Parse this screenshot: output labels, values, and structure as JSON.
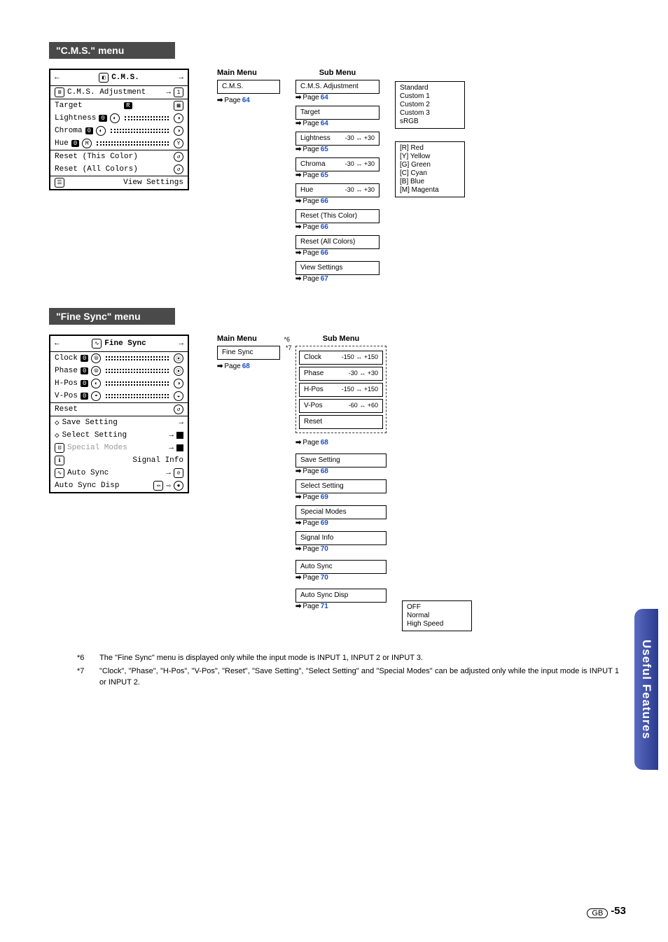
{
  "sidebar": {
    "label": "Useful Features"
  },
  "cms": {
    "title": "\"C.M.S.\" menu",
    "osd": {
      "title": "C.M.S.",
      "adjustment": "C.M.S. Adjustment",
      "adjustment_mode": "1",
      "target_label": "Target",
      "target_val": "R",
      "lightness_label": "Lightness",
      "lightness_val": "0",
      "chroma_label": "Chroma",
      "chroma_val": "0",
      "hue_label": "Hue",
      "hue_val": "0",
      "reset_this": "Reset (This Color)",
      "reset_all": "Reset (All Colors)",
      "view_settings": "View Settings"
    },
    "tree": {
      "main_heading": "Main Menu",
      "sub_heading": "Sub Menu",
      "main": {
        "label": "C.M.S.",
        "page": "64"
      },
      "subs": [
        {
          "label": "C.M.S. Adjustment",
          "page": "64",
          "opts": [
            "Standard",
            "Custom 1",
            "Custom 2",
            "Custom 3",
            "sRGB"
          ]
        },
        {
          "label": "Target",
          "page": "64",
          "opts": [
            "[R]  Red",
            "[Y]  Yellow",
            "[G]  Green",
            "[C]  Cyan",
            "[B]  Blue",
            "[M]  Magenta"
          ]
        },
        {
          "label": "Lightness",
          "range": "-30 ↔ +30",
          "page": "65"
        },
        {
          "label": "Chroma",
          "range": "-30 ↔ +30",
          "page": "65"
        },
        {
          "label": "Hue",
          "range": "-30 ↔ +30",
          "page": "66"
        },
        {
          "label": "Reset (This Color)",
          "page": "66"
        },
        {
          "label": "Reset (All Colors)",
          "page": "66"
        },
        {
          "label": "View Settings",
          "page": "67"
        }
      ]
    }
  },
  "fs": {
    "title": "\"Fine Sync\" menu",
    "osd": {
      "title": "Fine Sync",
      "clock": "Clock",
      "clock_val": "0",
      "phase": "Phase",
      "phase_val": "0",
      "hpos": "H-Pos",
      "hpos_val": "0",
      "vpos": "V-Pos",
      "vpos_val": "0",
      "reset": "Reset",
      "save": "Save Setting",
      "select": "Select Setting",
      "special": "Special Modes",
      "signal": "Signal Info",
      "autosync": "Auto Sync",
      "autosync_disp": "Auto Sync Disp"
    },
    "tree": {
      "main_heading": "Main Menu",
      "sub_heading": "Sub Menu",
      "star6": "*6",
      "star7": "*7",
      "main": {
        "label": "Fine Sync",
        "page": "68"
      },
      "group1": [
        {
          "label": "Clock",
          "range": "-150 ↔ +150"
        },
        {
          "label": "Phase",
          "range": "-30 ↔ +30"
        },
        {
          "label": "H-Pos",
          "range": "-150 ↔ +150"
        },
        {
          "label": "V-Pos",
          "range": "-60 ↔ +60"
        },
        {
          "label": "Reset"
        }
      ],
      "group1_page": "68",
      "subs2": [
        {
          "label": "Save Setting",
          "page": "68"
        },
        {
          "label": "Select Setting",
          "page": "69"
        },
        {
          "label": "Special Modes",
          "page": "69"
        },
        {
          "label": "Signal Info",
          "page": "70"
        }
      ],
      "auto_sync": {
        "label": "Auto Sync",
        "page": "70",
        "opts": [
          "OFF",
          "Normal",
          "High Speed"
        ]
      },
      "auto_sync_disp": {
        "label": "Auto Sync Disp",
        "page": "71"
      }
    }
  },
  "notes": {
    "n6": {
      "tag": "*6",
      "text": "The \"Fine Sync\" menu is displayed only while the input mode is INPUT 1, INPUT 2 or INPUT 3."
    },
    "n7": {
      "tag": "*7",
      "text": "\"Clock\", \"Phase\", \"H-Pos\", \"V-Pos\", \"Reset\", \"Save Setting\", \"Select Setting\" and \"Special Modes\" can be adjusted only while the input mode is INPUT 1 or INPUT 2."
    }
  },
  "footer": {
    "gb": "GB",
    "page": "-53"
  },
  "page_word": "Page"
}
